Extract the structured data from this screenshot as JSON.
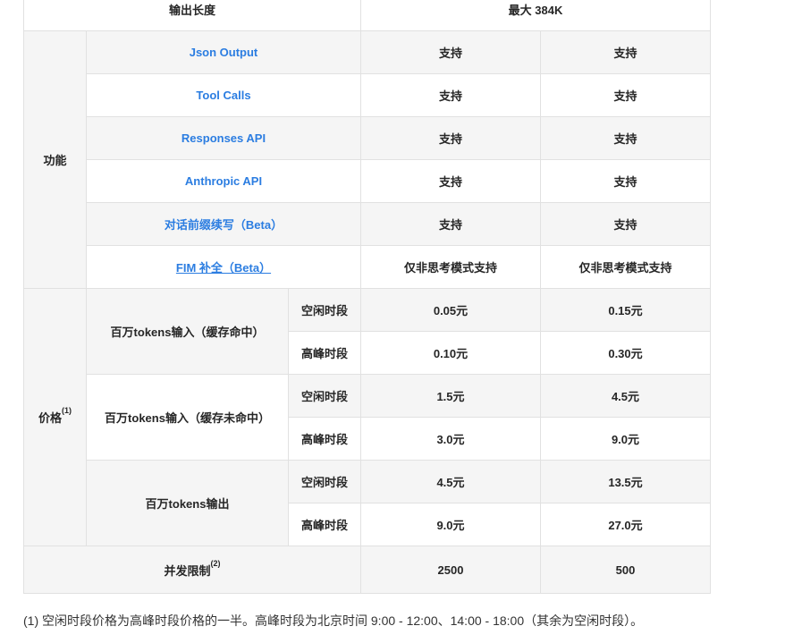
{
  "table": {
    "output_length": {
      "label": "输出长度",
      "value": "最大 384K"
    },
    "features": {
      "label": "功能",
      "rows": [
        {
          "name": "Json Output",
          "a": "支持",
          "b": "支持"
        },
        {
          "name": "Tool Calls",
          "a": "支持",
          "b": "支持"
        },
        {
          "name": "Responses API",
          "a": "支持",
          "b": "支持"
        },
        {
          "name": "Anthropic API",
          "a": "支持",
          "b": "支持"
        },
        {
          "name": "对话前缀续写（Beta）",
          "a": "支持",
          "b": "支持"
        },
        {
          "name": "FIM 补全（Beta）",
          "a": "仅非思考模式支持",
          "b": "仅非思考模式支持"
        }
      ]
    },
    "pricing": {
      "label": "价格",
      "label_sup": "(1)",
      "groups": [
        {
          "name": "百万tokens输入（缓存命中）",
          "rows": [
            {
              "period": "空闲时段",
              "a": "0.05元",
              "b": "0.15元"
            },
            {
              "period": "高峰时段",
              "a": "0.10元",
              "b": "0.30元"
            }
          ]
        },
        {
          "name": "百万tokens输入（缓存未命中）",
          "rows": [
            {
              "period": "空闲时段",
              "a": "1.5元",
              "b": "4.5元"
            },
            {
              "period": "高峰时段",
              "a": "3.0元",
              "b": "9.0元"
            }
          ]
        },
        {
          "name": "百万tokens输出",
          "rows": [
            {
              "period": "空闲时段",
              "a": "4.5元",
              "b": "13.5元"
            },
            {
              "period": "高峰时段",
              "a": "9.0元",
              "b": "27.0元"
            }
          ]
        }
      ]
    },
    "concurrency": {
      "label": "并发限制",
      "label_sup": "(2)",
      "a": "2500",
      "b": "500"
    }
  },
  "footnote": "(1) 空闲时段价格为高峰时段价格的一半。高峰时段为北京时间 9:00 - 12:00、14:00 - 18:00（其余为空闲时段）。"
}
